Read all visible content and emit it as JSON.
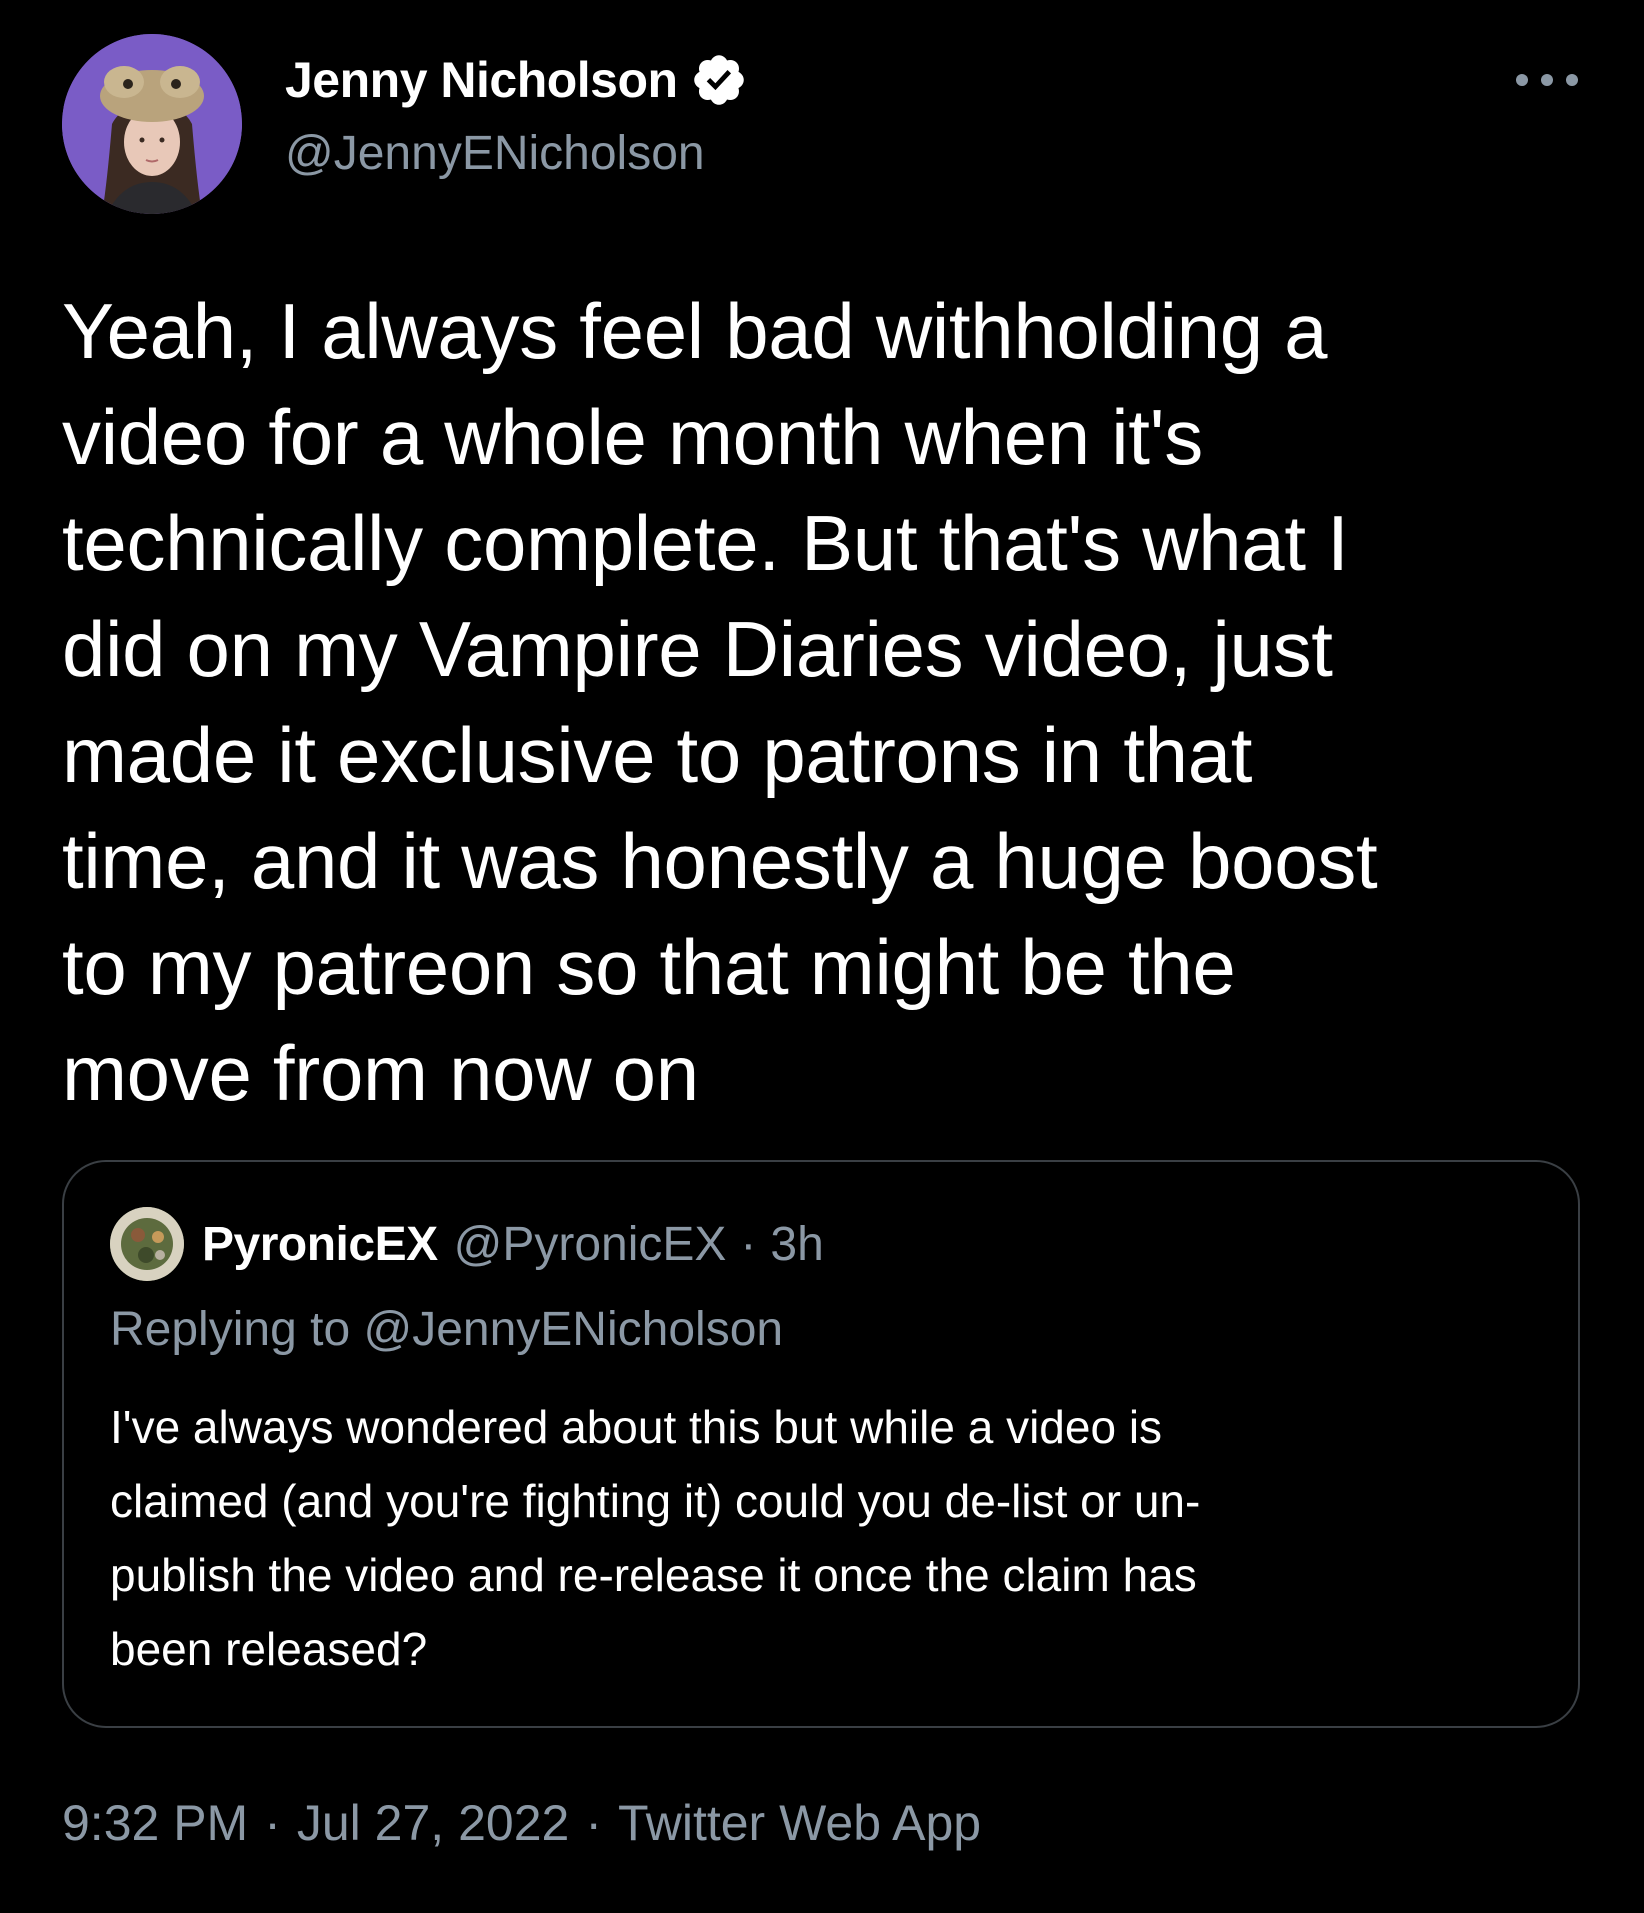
{
  "tweet": {
    "author": {
      "name": "Jenny Nicholson",
      "handle": "@JennyENicholson",
      "verified": true
    },
    "text_lines": [
      "Yeah, I always feel bad withholding a",
      "video for a whole month when it's",
      "technically complete. But that's what I",
      "did on my Vampire Diaries video, just",
      "made it exclusive to patrons in that",
      "time, and it was honestly a huge boost",
      "to my patreon so that might be the",
      "move from now on"
    ],
    "time": "9:32 PM",
    "date": "Jul 27, 2022",
    "source": "Twitter Web App",
    "separator": "·"
  },
  "quoted_tweet": {
    "name": "PyronicEX",
    "handle": "@PyronicEX",
    "separator": "·",
    "time": "3h",
    "replying_to": "Replying to @JennyENicholson",
    "text_lines": [
      "I've always wondered about this but while a video is",
      "claimed (and you're fighting it) could you de-list or un-",
      "publish the video and re-release it once the claim has",
      "been released?"
    ]
  },
  "colors": {
    "background": "#000000",
    "primary_text": "#ffffff",
    "secondary_text": "#8b98a5",
    "card_border": "#3a3f44"
  },
  "icons": {
    "verified": "verified-badge-icon",
    "more": "more-options-icon"
  }
}
